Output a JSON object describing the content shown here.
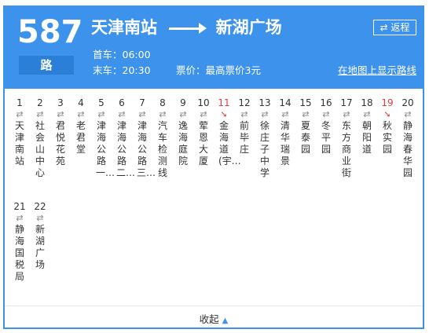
{
  "route": {
    "number": "587",
    "suffix": "路",
    "from": "天津南站",
    "to": "新湖广场",
    "first_bus": "首车：06:00",
    "last_bus": "末车：20:30",
    "fare": "票价：最高票价3元",
    "map_link": "在地图上显示路线",
    "return_label": "⇄ 返程"
  },
  "stops": [
    {
      "num": "1",
      "name": "天津南站",
      "current": false
    },
    {
      "num": "2",
      "name": "社会山中心",
      "current": false
    },
    {
      "num": "3",
      "name": "君悦花苑",
      "current": false
    },
    {
      "num": "4",
      "name": "老君堂",
      "current": false
    },
    {
      "num": "5",
      "name": "津海公路一…",
      "current": false
    },
    {
      "num": "6",
      "name": "津海公路二…",
      "current": false
    },
    {
      "num": "7",
      "name": "津海公路三…",
      "current": false
    },
    {
      "num": "8",
      "name": "汽车检测线",
      "current": false
    },
    {
      "num": "9",
      "name": "逸海庭院",
      "current": false
    },
    {
      "num": "10",
      "name": "荤恩大厦",
      "current": false
    },
    {
      "num": "11",
      "name": "金海道(宇…",
      "current": true
    },
    {
      "num": "12",
      "name": "前毕庄",
      "current": false
    },
    {
      "num": "13",
      "name": "徐庄子中学",
      "current": false
    },
    {
      "num": "14",
      "name": "清华瑞景",
      "current": false
    },
    {
      "num": "15",
      "name": "夏泰园",
      "current": false
    },
    {
      "num": "16",
      "name": "冬平园",
      "current": false
    },
    {
      "num": "17",
      "name": "东方商业街",
      "current": false
    },
    {
      "num": "18",
      "name": "朝阳道",
      "current": false
    },
    {
      "num": "19",
      "name": "秋实园",
      "current": true
    },
    {
      "num": "20",
      "name": "静海春华园",
      "current": false
    },
    {
      "num": "21",
      "name": "静海国税局",
      "current": false
    },
    {
      "num": "22",
      "name": "新湖广场",
      "current": false
    }
  ],
  "footer": {
    "collapse_label": "收起"
  }
}
